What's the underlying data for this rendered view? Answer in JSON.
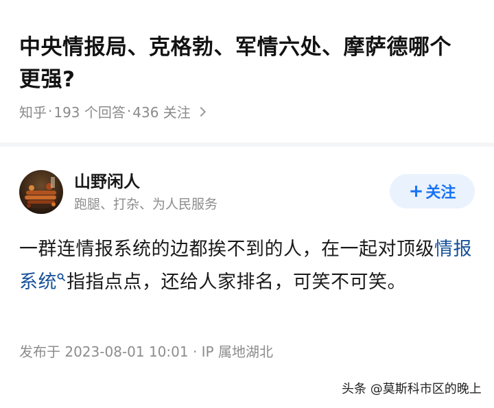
{
  "question": {
    "title": "中央情报局、克格勃、军情六处、摩萨德哪个更强?",
    "source": "知乎",
    "answers": "193 个回答",
    "followers": "436 关注",
    "separator": "·"
  },
  "author": {
    "name": "山野闲人",
    "bio": "跑腿、打杂、为人民服务",
    "follow_label": "关注",
    "follow_plus": "+"
  },
  "answer": {
    "text_before": "一群连情报系统的边都挨不到的人，在一起对顶级",
    "keyword": "情报系统",
    "text_after": "指指点点，还给人家排名，可笑不可笑。"
  },
  "publish_info": "发布于 2023-08-01 10:01 · IP 属地湖北",
  "watermark": "头条 @莫斯科市区的晚上",
  "colors": {
    "link": "#175199",
    "accent": "#1772f6",
    "follow_bg": "#eaf2fd",
    "meta": "#8c8c8c"
  }
}
